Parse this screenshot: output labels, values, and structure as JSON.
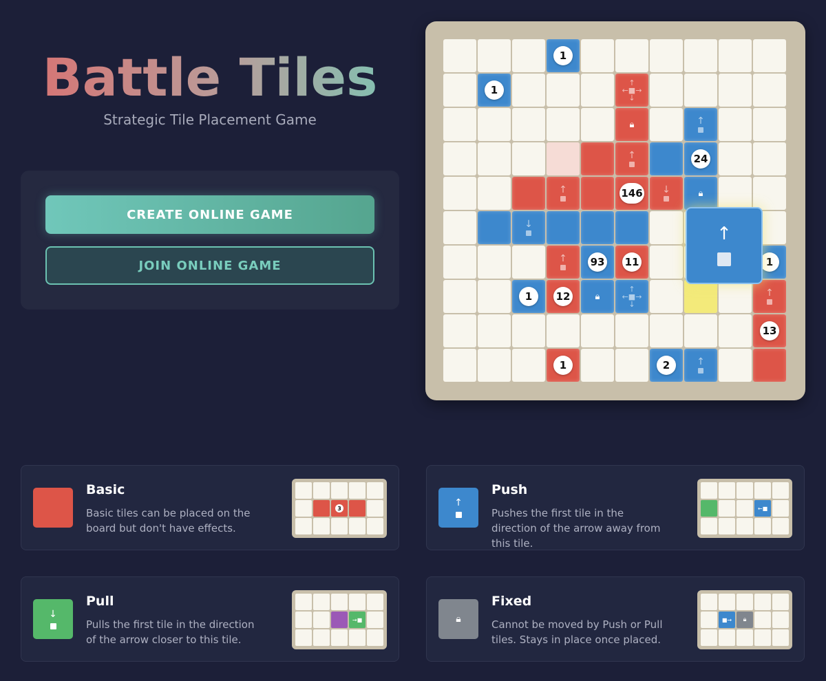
{
  "header": {
    "title": "Battle Tiles",
    "subtitle": "Strategic Tile Placement Game"
  },
  "menu": {
    "create_label": "CREATE ONLINE GAME",
    "join_label": "JOIN ONLINE GAME"
  },
  "board": {
    "size": 10,
    "tiles": [
      {
        "r": 0,
        "c": 3,
        "color": "blue",
        "num": "1"
      },
      {
        "r": 1,
        "c": 1,
        "color": "blue",
        "num": "1"
      },
      {
        "r": 1,
        "c": 5,
        "color": "red",
        "icon": "cross-arrows"
      },
      {
        "r": 2,
        "c": 5,
        "color": "red",
        "icon": "lock"
      },
      {
        "r": 2,
        "c": 7,
        "color": "blue",
        "icon": "push-up"
      },
      {
        "r": 3,
        "c": 3,
        "color": "pink"
      },
      {
        "r": 3,
        "c": 4,
        "color": "red"
      },
      {
        "r": 3,
        "c": 5,
        "color": "red",
        "icon": "push-up"
      },
      {
        "r": 3,
        "c": 6,
        "color": "blue"
      },
      {
        "r": 3,
        "c": 7,
        "color": "blue",
        "num": "24"
      },
      {
        "r": 4,
        "c": 2,
        "color": "red"
      },
      {
        "r": 4,
        "c": 3,
        "color": "red",
        "icon": "push-up"
      },
      {
        "r": 4,
        "c": 4,
        "color": "red"
      },
      {
        "r": 4,
        "c": 5,
        "color": "red",
        "num": "146"
      },
      {
        "r": 4,
        "c": 6,
        "color": "red",
        "icon": "pull-down"
      },
      {
        "r": 4,
        "c": 7,
        "color": "blue",
        "icon": "lock"
      },
      {
        "r": 5,
        "c": 1,
        "color": "blue"
      },
      {
        "r": 5,
        "c": 2,
        "color": "blue",
        "icon": "pull-down"
      },
      {
        "r": 5,
        "c": 3,
        "color": "blue"
      },
      {
        "r": 5,
        "c": 4,
        "color": "blue"
      },
      {
        "r": 5,
        "c": 5,
        "color": "blue"
      },
      {
        "r": 6,
        "c": 3,
        "color": "red",
        "icon": "push-up"
      },
      {
        "r": 6,
        "c": 4,
        "color": "blue",
        "num": "93"
      },
      {
        "r": 6,
        "c": 5,
        "color": "red",
        "num": "11"
      },
      {
        "r": 6,
        "c": 9,
        "color": "blue",
        "num": "1"
      },
      {
        "r": 7,
        "c": 2,
        "color": "blue",
        "num": "1"
      },
      {
        "r": 7,
        "c": 3,
        "color": "red",
        "num": "12"
      },
      {
        "r": 7,
        "c": 4,
        "color": "blue",
        "icon": "lock"
      },
      {
        "r": 7,
        "c": 5,
        "color": "blue",
        "icon": "cross-arrows"
      },
      {
        "r": 7,
        "c": 7,
        "color": "yellow"
      },
      {
        "r": 7,
        "c": 9,
        "color": "red",
        "icon": "push-up"
      },
      {
        "r": 8,
        "c": 9,
        "color": "red",
        "num": "13"
      },
      {
        "r": 9,
        "c": 3,
        "color": "red",
        "num": "1"
      },
      {
        "r": 9,
        "c": 6,
        "color": "blue",
        "num": "2"
      },
      {
        "r": 9,
        "c": 7,
        "color": "blue",
        "icon": "push-up"
      },
      {
        "r": 9,
        "c": 9,
        "color": "red"
      }
    ],
    "hover_tile": {
      "color": "blue",
      "icon": "push-up"
    }
  },
  "tile_types": {
    "basic": {
      "name": "Basic",
      "desc": "Basic tiles can be placed on the board but don't have effects.",
      "color": "#dd5548",
      "example_num": "3"
    },
    "push": {
      "name": "Push",
      "desc": "Pushes the first tile in the direction of the arrow away from this tile.",
      "color": "#3d88cd"
    },
    "pull": {
      "name": "Pull",
      "desc": "Pulls the first tile in the direction of the arrow closer to this tile.",
      "color": "#55b86a"
    },
    "fixed": {
      "name": "Fixed",
      "desc": "Cannot be moved by Push or Pull tiles. Stays in place once placed.",
      "color": "#80868e"
    }
  },
  "colors": {
    "background": "#1c1f38",
    "red": "#dd5548",
    "blue": "#3d88cd",
    "green": "#55b86a",
    "teal": "#70c7ba"
  }
}
